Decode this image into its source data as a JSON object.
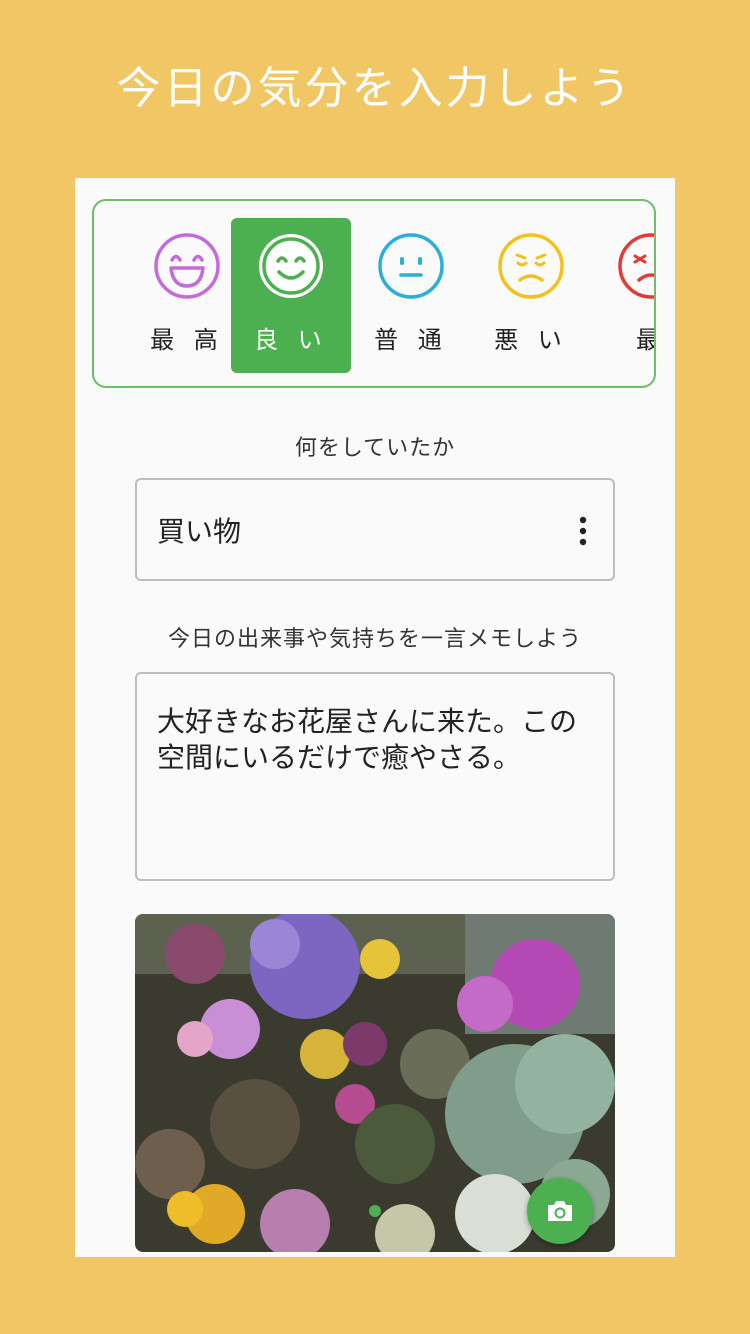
{
  "headline": "今日の気分を入力しよう",
  "moods": {
    "items": [
      {
        "label": "最 高",
        "icon": "laughing-face-icon",
        "color": "#C56BD9"
      },
      {
        "label": "良 い",
        "icon": "smiling-face-icon",
        "color": "#4CAF50"
      },
      {
        "label": "普 通",
        "icon": "neutral-face-icon",
        "color": "#29B0D6"
      },
      {
        "label": "悪 い",
        "icon": "sad-face-icon",
        "color": "#F1C21B"
      },
      {
        "label": "最",
        "icon": "angry-face-icon",
        "color": "#E53935"
      }
    ],
    "selected_index": 1
  },
  "activity": {
    "label": "何をしていたか",
    "value": "買い物",
    "menu_icon": "more-vertical-icon"
  },
  "memo": {
    "label": "今日の出来事や気持ちを一言メモしよう",
    "text": "大好きなお花屋さんに来た。この空間にいるだけで癒やさる。"
  },
  "photo": {
    "camera_button_icon": "camera-icon",
    "accent_color": "#4CAF50"
  }
}
